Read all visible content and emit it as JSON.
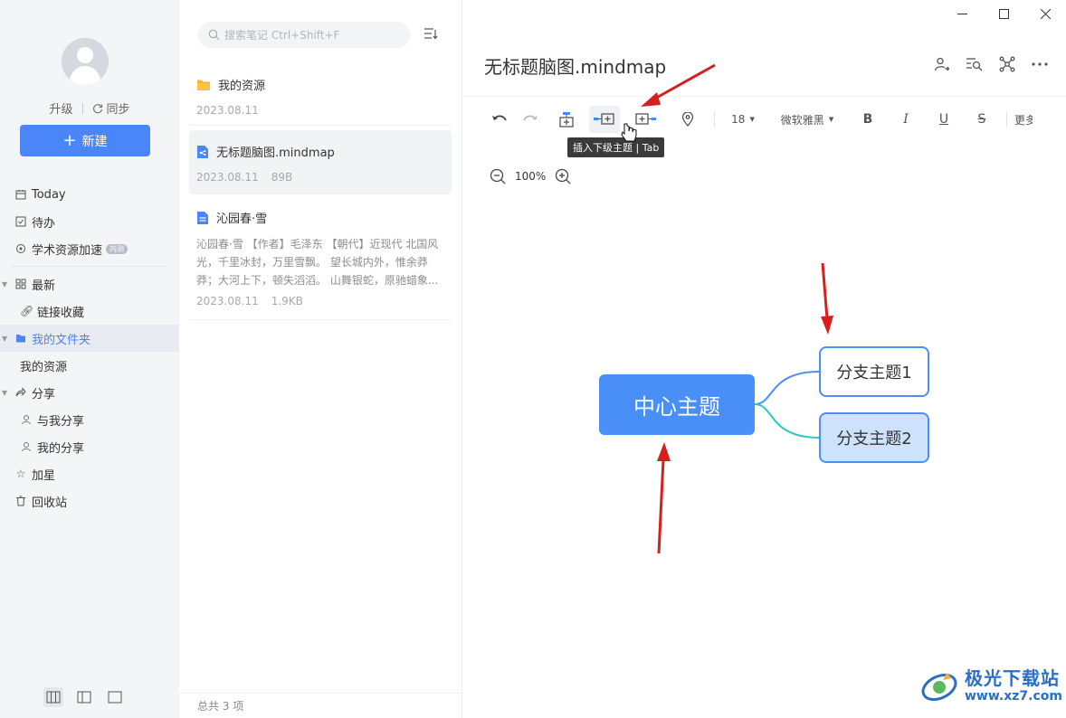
{
  "sidebar": {
    "upgrade_label": "升级",
    "sync_label": "同步",
    "new_label": "新建",
    "nav": {
      "today": "Today",
      "todo": "待办",
      "academic": "学术资源加速",
      "academic_tag": "内测",
      "recent": "最新",
      "links": "链接收藏",
      "my_folder": "我的文件夹",
      "my_resources": "我的资源",
      "share": "分享",
      "shared_with_me": "与我分享",
      "my_share": "我的分享",
      "starred": "加星",
      "trash": "回收站"
    }
  },
  "list": {
    "search_placeholder": "搜索笔记 Ctrl+Shift+F",
    "notes": [
      {
        "title": "我的资源",
        "date": "2023.08.11",
        "size": ""
      },
      {
        "title": "无标题脑图.mindmap",
        "date": "2023.08.11",
        "size": "89B"
      },
      {
        "title": "沁园春·雪",
        "excerpt": "沁园春·雪 【作者】毛泽东 【朝代】近现代 北国风光，千里冰封，万里雪飘。 望长城内外，惟余莽莽；大河上下，顿失滔滔。 山舞银蛇，原驰蜡象...",
        "date": "2023.08.11",
        "size": "1.9KB"
      }
    ],
    "footer": "总共 3 项"
  },
  "editor": {
    "title": "无标题脑图.mindmap",
    "toolbar": {
      "font_size": "18",
      "font_family": "微软雅黑",
      "bold": "B",
      "italic": "I",
      "underline": "U",
      "strike": "S",
      "more": "更多"
    },
    "tooltip": "插入下级主题 | Tab",
    "zoom": "100%",
    "mindmap": {
      "center": "中心主题",
      "branches": [
        "分支主题1",
        "分支主题2"
      ]
    }
  },
  "watermark": {
    "name": "极光下载站",
    "url": "www.xz7.com"
  },
  "colors": {
    "accent": "#4a86f7",
    "arrow": "#d81e1e",
    "branch_line_1": "#4a8ff7",
    "branch_line_2": "#2bc6c6"
  }
}
